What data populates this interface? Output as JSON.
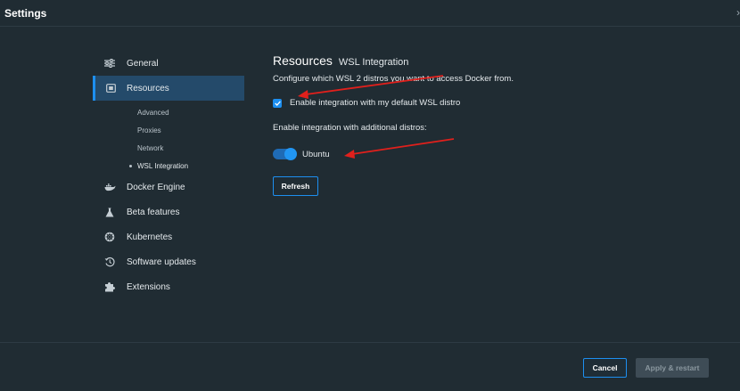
{
  "window": {
    "title": "Settings",
    "close_icon": "chevron-icon"
  },
  "sidebar": {
    "items": [
      {
        "label": "General",
        "icon": "sliders-icon"
      },
      {
        "label": "Resources",
        "icon": "chip-icon",
        "active": true
      },
      {
        "label": "Docker Engine",
        "icon": "whale-icon"
      },
      {
        "label": "Beta features",
        "icon": "flask-icon"
      },
      {
        "label": "Kubernetes",
        "icon": "helm-icon"
      },
      {
        "label": "Software updates",
        "icon": "history-icon"
      },
      {
        "label": "Extensions",
        "icon": "puzzle-icon"
      }
    ],
    "subitems": [
      {
        "label": "Advanced"
      },
      {
        "label": "Proxies"
      },
      {
        "label": "Network"
      },
      {
        "label": "WSL Integration",
        "current": true
      }
    ]
  },
  "main": {
    "title": "Resources",
    "subtitle": "WSL Integration",
    "description": "Configure which WSL 2 distros you want to access Docker from.",
    "default_distro": {
      "label": "Enable integration with my default WSL distro",
      "checked": true
    },
    "additional_label": "Enable integration with additional distros:",
    "distros": [
      {
        "label": "Ubuntu",
        "enabled": true
      }
    ],
    "refresh_label": "Refresh"
  },
  "footer": {
    "cancel_label": "Cancel",
    "apply_label": "Apply & restart",
    "apply_disabled": true
  },
  "colors": {
    "accent": "#1d8ff0",
    "background": "#202c33",
    "active_bg": "#244a6a",
    "annotation": "#e0201c"
  }
}
